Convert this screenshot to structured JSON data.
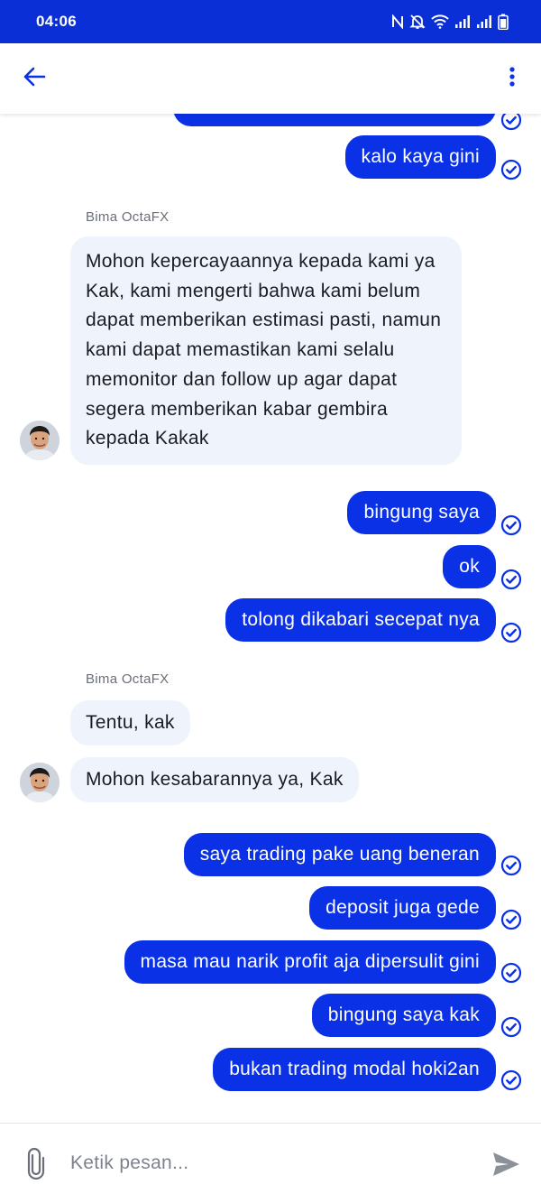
{
  "status_bar": {
    "time": "04:06",
    "icons": [
      "nfc-icon",
      "mute-icon",
      "wifi-icon",
      "signal-icon",
      "signal-icon",
      "battery-icon"
    ]
  },
  "app_bar": {
    "back_icon": "arrow-left-icon",
    "menu_icon": "more-vertical-icon"
  },
  "colors": {
    "accent": "#0a31e6",
    "status_bar": "#0a2fd6",
    "incoming_bubble": "#eff3fc"
  },
  "chat": {
    "top_partial_outgoing": "kalo kaya gini",
    "outgoing_1": [
      "kalo kaya gini"
    ],
    "incoming_1": {
      "sender": "Bima OctaFX",
      "text": "Mohon kepercayaannya kepada kami ya Kak, kami mengerti bahwa kami belum dapat memberikan estimasi pasti, namun kami dapat memastikan kami selalu memonitor dan follow up agar dapat segera memberikan kabar gembira kepada Kakak"
    },
    "outgoing_2": [
      "bingung saya",
      "ok",
      "tolong dikabari secepat nya"
    ],
    "incoming_2": {
      "sender": "Bima OctaFX",
      "messages": [
        "Tentu, kak",
        "Mohon kesabarannya ya, Kak"
      ]
    },
    "outgoing_3": [
      "saya trading pake uang beneran",
      "deposit juga gede",
      "masa mau narik profit aja dipersulit gini",
      "bingung saya kak",
      "bukan trading modal hoki2an"
    ]
  },
  "input": {
    "placeholder": "Ketik pesan...",
    "attach_icon": "paperclip-icon",
    "send_icon": "send-icon"
  }
}
